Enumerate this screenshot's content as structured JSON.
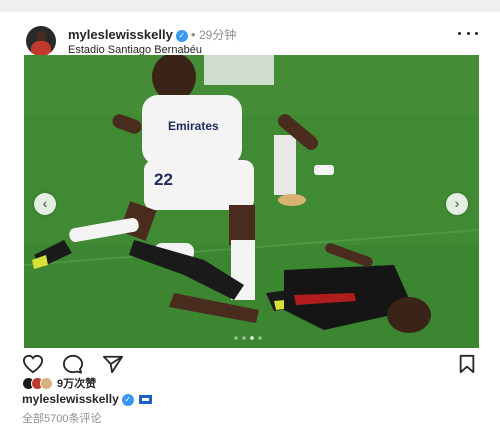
{
  "post": {
    "username": "myleslewisskelly",
    "time_sep": "•",
    "time_ago": "29分钟",
    "location": "Estadio Santiago Bernabéu",
    "media": {
      "jersey_sponsor": "Emirates",
      "jersey_number": "22",
      "carousel_count": 4,
      "carousel_active": 3
    },
    "icons": {
      "more": "more-options-icon",
      "like": "heart-icon",
      "comment": "comment-icon",
      "share": "send-icon",
      "save": "bookmark-icon",
      "prev": "chevron-left-icon",
      "next": "chevron-right-icon"
    },
    "nav_prev": "‹",
    "nav_next": "›",
    "likes_text": "9万次赞",
    "caption_username": "myleslewisskelly",
    "comments_link": "全部5700条评论"
  },
  "colors": {
    "verified": "#3897f0",
    "pitch": "#3f8a33",
    "muted_text": "#8e8e8e"
  }
}
